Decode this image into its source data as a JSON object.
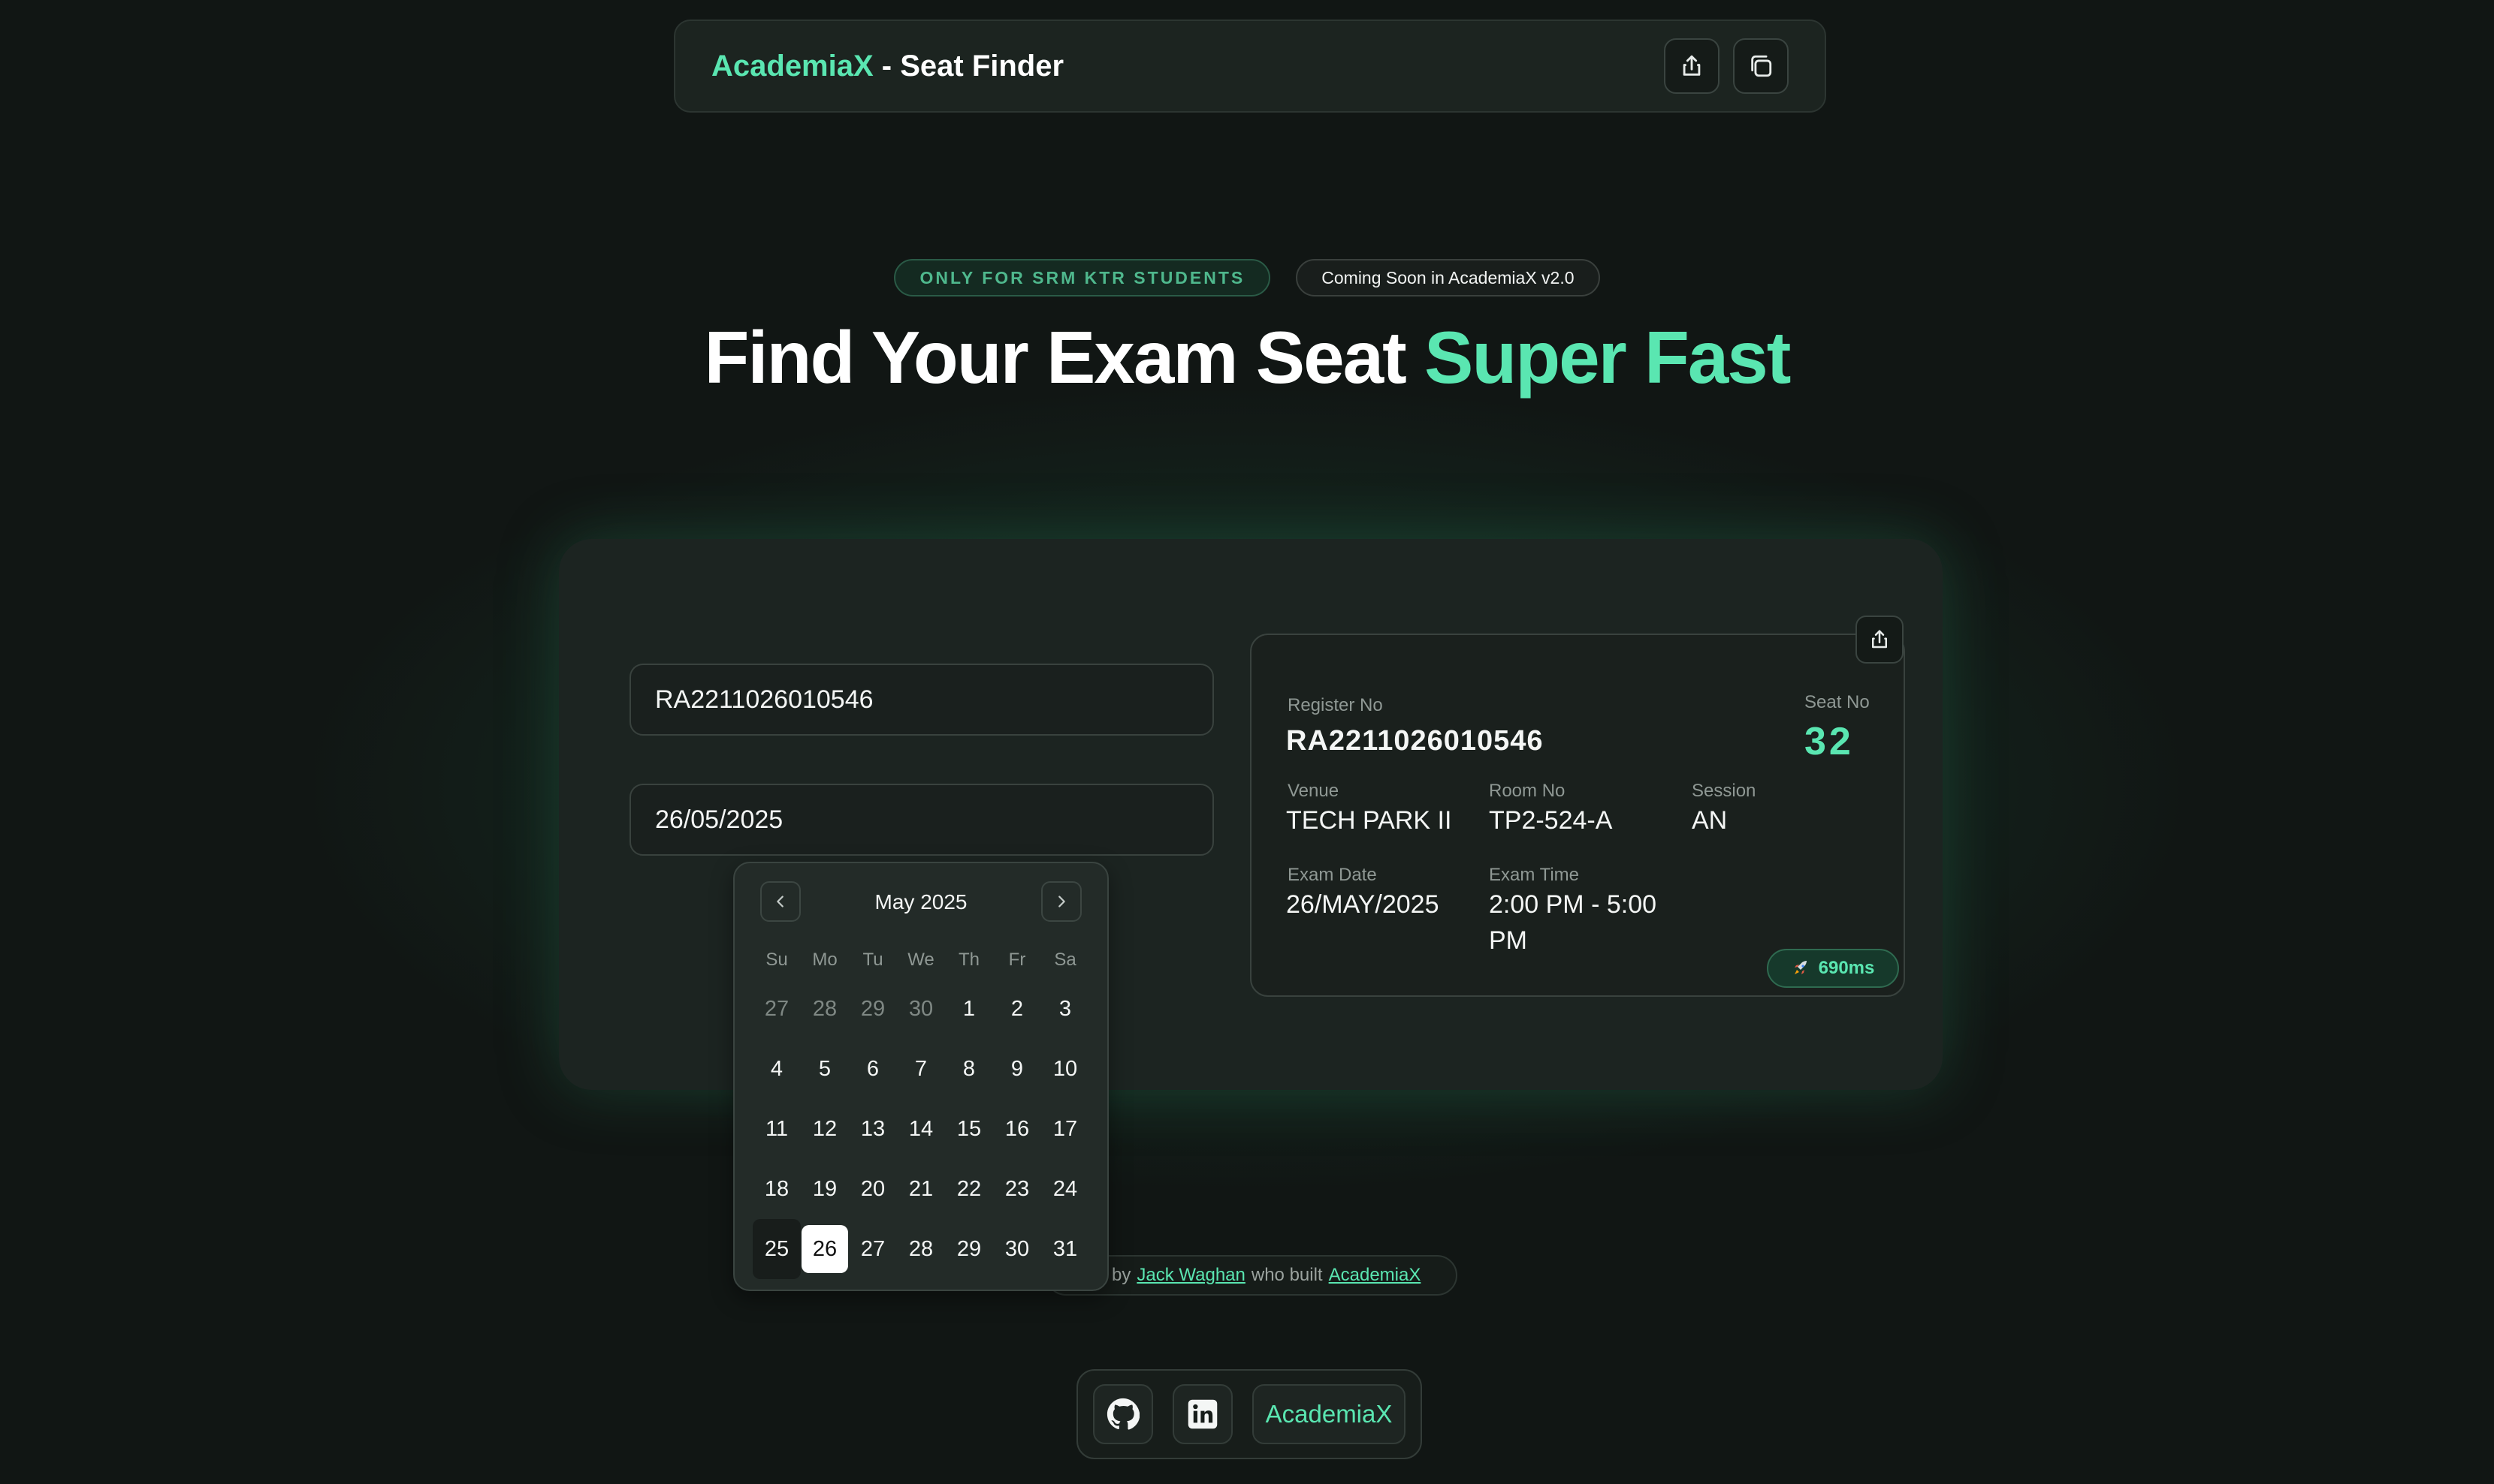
{
  "header": {
    "brand_accent": "AcademiaX",
    "brand_rest": " - Seat Finder",
    "share_icon": "share-icon",
    "copy_icon": "copy-icon"
  },
  "badges": {
    "audience": "ONLY FOR SRM KTR STUDENTS",
    "coming_soon": "Coming Soon in AcademiaX v2.0"
  },
  "hero": {
    "title_main": "Find Your Exam Seat ",
    "title_accent": "Super Fast"
  },
  "form": {
    "register_value": "RA2211026010546",
    "date_value": "26/05/2025"
  },
  "result": {
    "register_label": "Register No",
    "register_value": "RA2211026010546",
    "seat_label": "Seat No",
    "seat_value": "32",
    "venue_label": "Venue",
    "venue_value": "TECH PARK II",
    "room_label": "Room No",
    "room_value": "TP2-524-A",
    "session_label": "Session",
    "session_value": "AN",
    "date_label": "Exam Date",
    "date_value": "26/MAY/2025",
    "time_label": "Exam Time",
    "time_value_line1": "2:00 PM - 5:00",
    "time_value_line2": "PM",
    "timing": "690ms",
    "timing_icon": "rocket-icon"
  },
  "calendar": {
    "month": "May 2025",
    "weekdays": [
      "Su",
      "Mo",
      "Tu",
      "We",
      "Th",
      "Fr",
      "Sa"
    ],
    "days": [
      {
        "d": "27",
        "out": true
      },
      {
        "d": "28",
        "out": true
      },
      {
        "d": "29",
        "out": true
      },
      {
        "d": "30",
        "out": true
      },
      {
        "d": "1"
      },
      {
        "d": "2"
      },
      {
        "d": "3"
      },
      {
        "d": "4"
      },
      {
        "d": "5"
      },
      {
        "d": "6"
      },
      {
        "d": "7"
      },
      {
        "d": "8"
      },
      {
        "d": "9"
      },
      {
        "d": "10"
      },
      {
        "d": "11"
      },
      {
        "d": "12"
      },
      {
        "d": "13"
      },
      {
        "d": "14"
      },
      {
        "d": "15"
      },
      {
        "d": "16"
      },
      {
        "d": "17"
      },
      {
        "d": "18"
      },
      {
        "d": "19"
      },
      {
        "d": "20"
      },
      {
        "d": "21"
      },
      {
        "d": "22"
      },
      {
        "d": "23"
      },
      {
        "d": "24"
      },
      {
        "d": "25",
        "today": true
      },
      {
        "d": "26",
        "selected": true
      },
      {
        "d": "27"
      },
      {
        "d": "28"
      },
      {
        "d": "29"
      },
      {
        "d": "30"
      },
      {
        "d": "31"
      }
    ]
  },
  "credit": {
    "prefix": "by",
    "author": "Jack Waghan",
    "middle": "who built",
    "project": "AcademiaX"
  },
  "footer": {
    "github_icon": "github-icon",
    "linkedin_icon": "linkedin-icon",
    "academiax_label": "AcademiaX"
  },
  "colors": {
    "accent": "#5ae6b1",
    "background": "#111614",
    "card": "#1c2421"
  }
}
